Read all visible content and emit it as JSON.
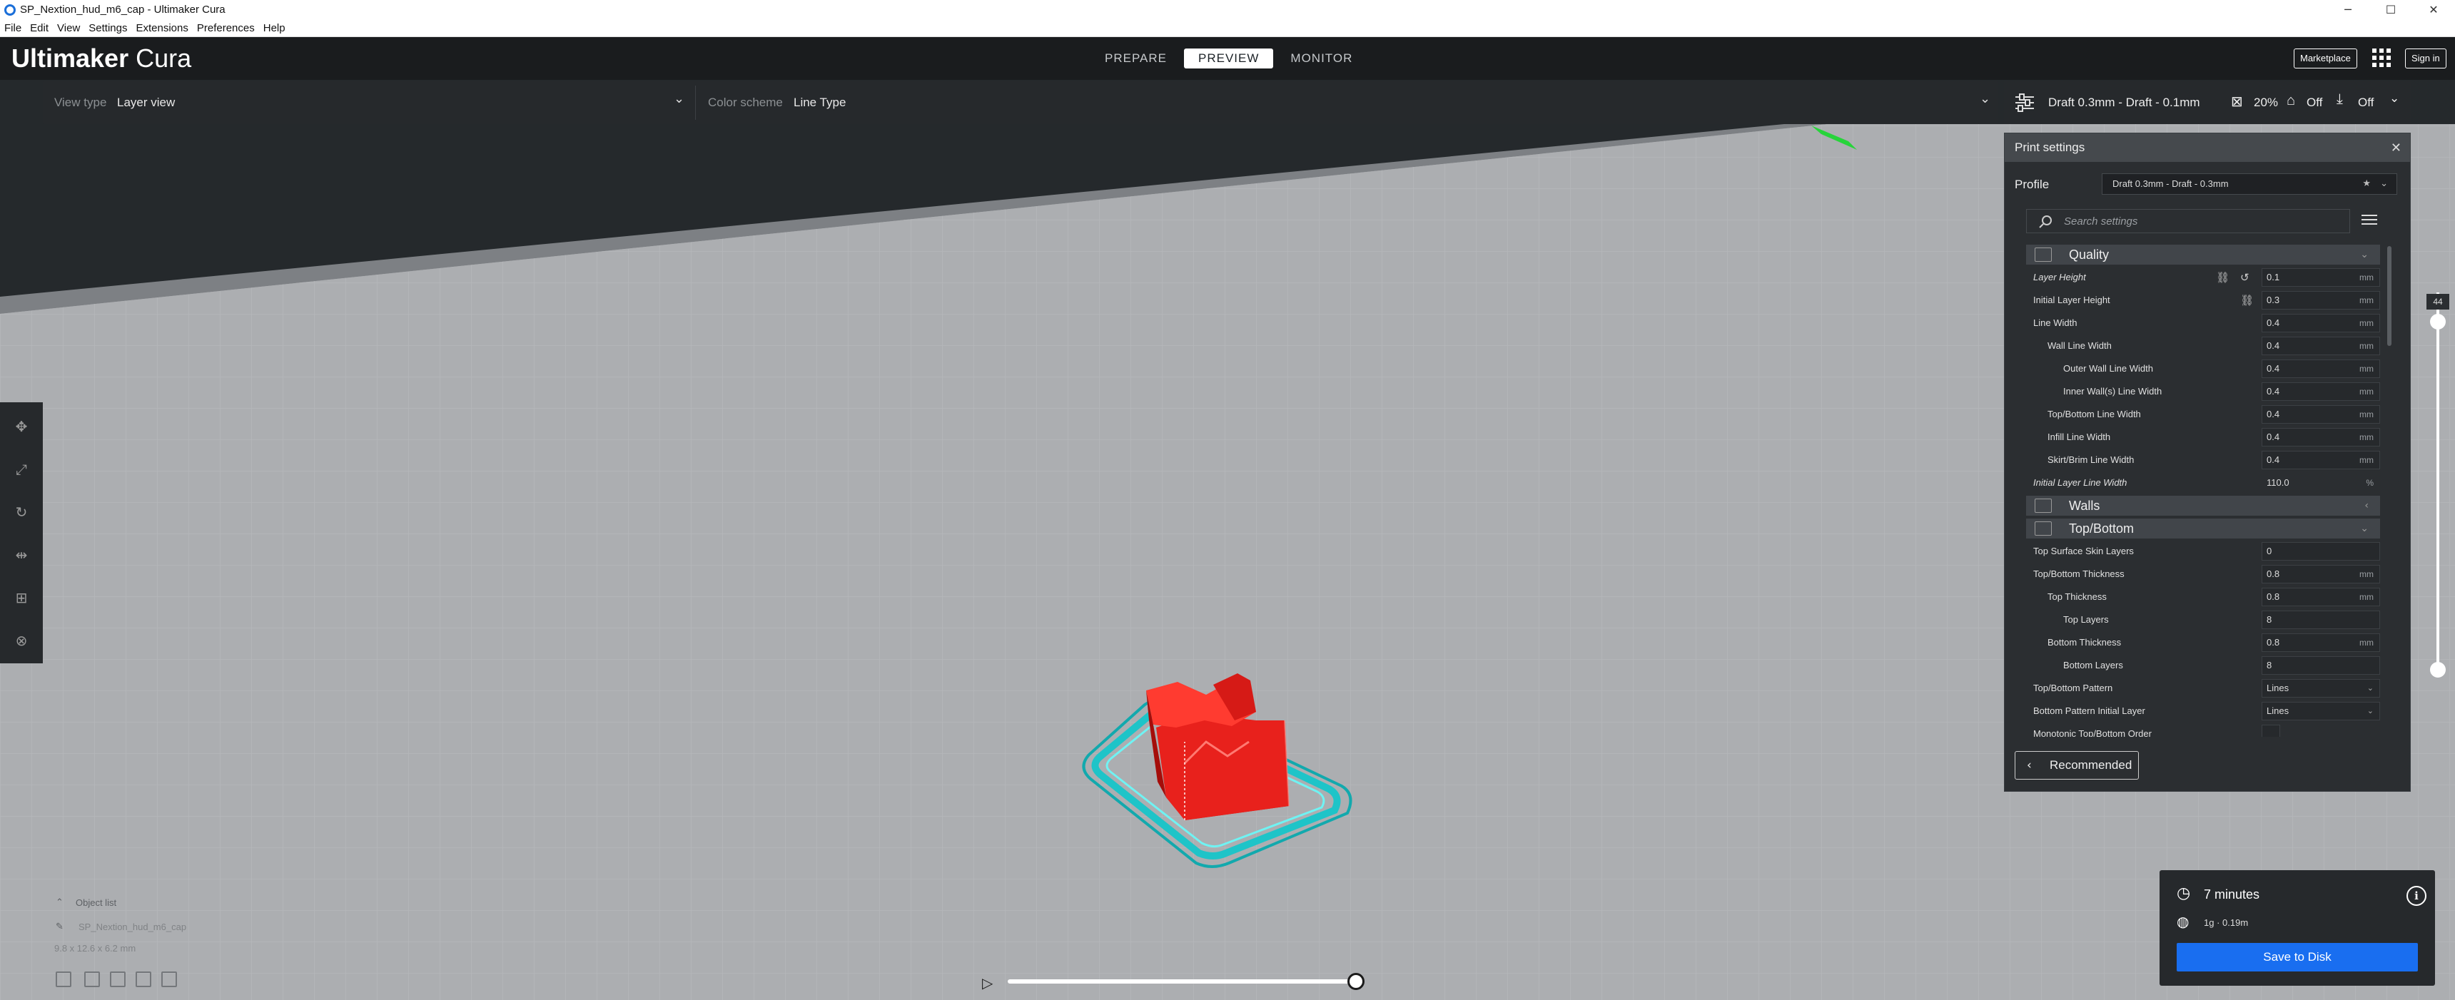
{
  "window": {
    "title": "SP_Nextion_hud_m6_cap - Ultimaker Cura",
    "minimize": "─",
    "maximize": "☐",
    "close": "✕"
  },
  "menu": [
    "File",
    "Edit",
    "View",
    "Settings",
    "Extensions",
    "Preferences",
    "Help"
  ],
  "header": {
    "logo_brand": "Ultimaker",
    "logo_product": "Cura",
    "stages": [
      "PREPARE",
      "PREVIEW",
      "MONITOR"
    ],
    "active_stage": "PREVIEW",
    "marketplace": "Marketplace",
    "signin": "Sign in"
  },
  "viewbar": {
    "view_type_label": "View type",
    "view_type_value": "Layer view",
    "color_scheme_label": "Color scheme",
    "color_scheme_value": "Line Type"
  },
  "profile_bar": {
    "profile": "Draft 0.3mm - Draft - 0.1mm",
    "infill": "20%",
    "support": "Off",
    "adhesion": "Off"
  },
  "print_settings": {
    "title": "Print settings",
    "profile_label": "Profile",
    "profile_value": "Draft 0.3mm - Draft - 0.3mm",
    "search_placeholder": "Search settings",
    "quality": {
      "title": "Quality",
      "rows": [
        {
          "label": "Layer Height",
          "value": "0.1",
          "unit": "mm"
        },
        {
          "label": "Initial Layer Height",
          "value": "0.3",
          "unit": "mm"
        },
        {
          "label": "Line Width",
          "value": "0.4",
          "unit": "mm"
        },
        {
          "label": "Wall Line Width",
          "value": "0.4",
          "unit": "mm"
        },
        {
          "label": "Outer Wall Line Width",
          "value": "0.4",
          "unit": "mm"
        },
        {
          "label": "Inner Wall(s) Line Width",
          "value": "0.4",
          "unit": "mm"
        },
        {
          "label": "Top/Bottom Line Width",
          "value": "0.4",
          "unit": "mm"
        },
        {
          "label": "Infill Line Width",
          "value": "0.4",
          "unit": "mm"
        },
        {
          "label": "Skirt/Brim Line Width",
          "value": "0.4",
          "unit": "mm"
        },
        {
          "label": "Initial Layer Line Width",
          "value": "110.0",
          "unit": "%"
        }
      ]
    },
    "walls": {
      "title": "Walls"
    },
    "topbottom": {
      "title": "Top/Bottom",
      "rows": [
        {
          "label": "Top Surface Skin Layers",
          "value": "0",
          "unit": ""
        },
        {
          "label": "Top/Bottom Thickness",
          "value": "0.8",
          "unit": "mm"
        },
        {
          "label": "Top Thickness",
          "value": "0.8",
          "unit": "mm"
        },
        {
          "label": "Top Layers",
          "value": "8",
          "unit": ""
        },
        {
          "label": "Bottom Thickness",
          "value": "0.8",
          "unit": "mm"
        },
        {
          "label": "Bottom Layers",
          "value": "8",
          "unit": ""
        },
        {
          "label": "Top/Bottom Pattern",
          "value": "Lines",
          "unit": ""
        },
        {
          "label": "Bottom Pattern Initial Layer",
          "value": "Lines",
          "unit": ""
        },
        {
          "label": "Monotonic Top/Bottom Order",
          "value": "",
          "unit": ""
        }
      ]
    },
    "recommended": "Recommended"
  },
  "layer_slider": {
    "current_layer": "44"
  },
  "object_list": {
    "title": "Object list",
    "object_name": "SP_Nextion_hud_m6_cap",
    "dimensions": "9.8 x 12.6 x 6.2 mm"
  },
  "estimate": {
    "time": "7 minutes",
    "material": "1g · 0.19m",
    "save": "Save to Disk"
  },
  "colors": {
    "accent": "#196ef0",
    "header": "#1a1c1e",
    "panel": "#2b2e31",
    "model": "#e8211c",
    "skirt": "#2fd6d6"
  }
}
